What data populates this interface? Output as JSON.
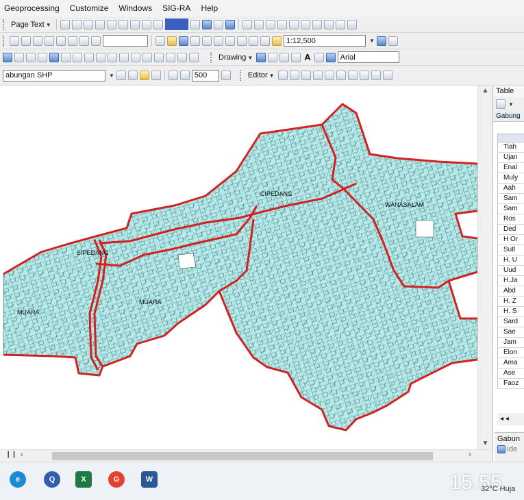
{
  "menu": [
    "Geoprocessing",
    "Customize",
    "Windows",
    "SIG-RA",
    "Help"
  ],
  "toolbar1": {
    "page_text": "Page Text"
  },
  "toolbar2": {
    "scale_value": "1:12,500"
  },
  "toolbar3": {
    "drawing_label": "Drawing",
    "font_value": "Arial"
  },
  "toolbar4": {
    "layer_value": "abungan SHP",
    "buffer_value": "500",
    "editor_label": "Editor"
  },
  "map": {
    "labels": [
      "CIPEDANG",
      "WANASALAM",
      "SIPEDANG",
      "MUARA",
      "MUARA"
    ],
    "fill_color": "#b2ebea",
    "boundary_color": "#d42020"
  },
  "table_panel": {
    "title": "Table",
    "subtitle": "Gabung",
    "rows": [
      "Tiah",
      "Ujan",
      "Enal",
      "Muly",
      "Aah",
      "Sam",
      "Sam",
      "Ros",
      "Ded",
      "H Or",
      "Sutl",
      "H. U",
      "Uud",
      "H.Ja",
      "Abd",
      "H. Z",
      "H. S",
      "Sard",
      "Sae",
      "Jam",
      "Elon",
      "Ama",
      "Ase",
      "Faoz"
    ],
    "tab_label": "Gabun",
    "tab_item": "Ide"
  },
  "statusbar": {
    "clock": "15.55",
    "weather": "32°C Huja"
  }
}
